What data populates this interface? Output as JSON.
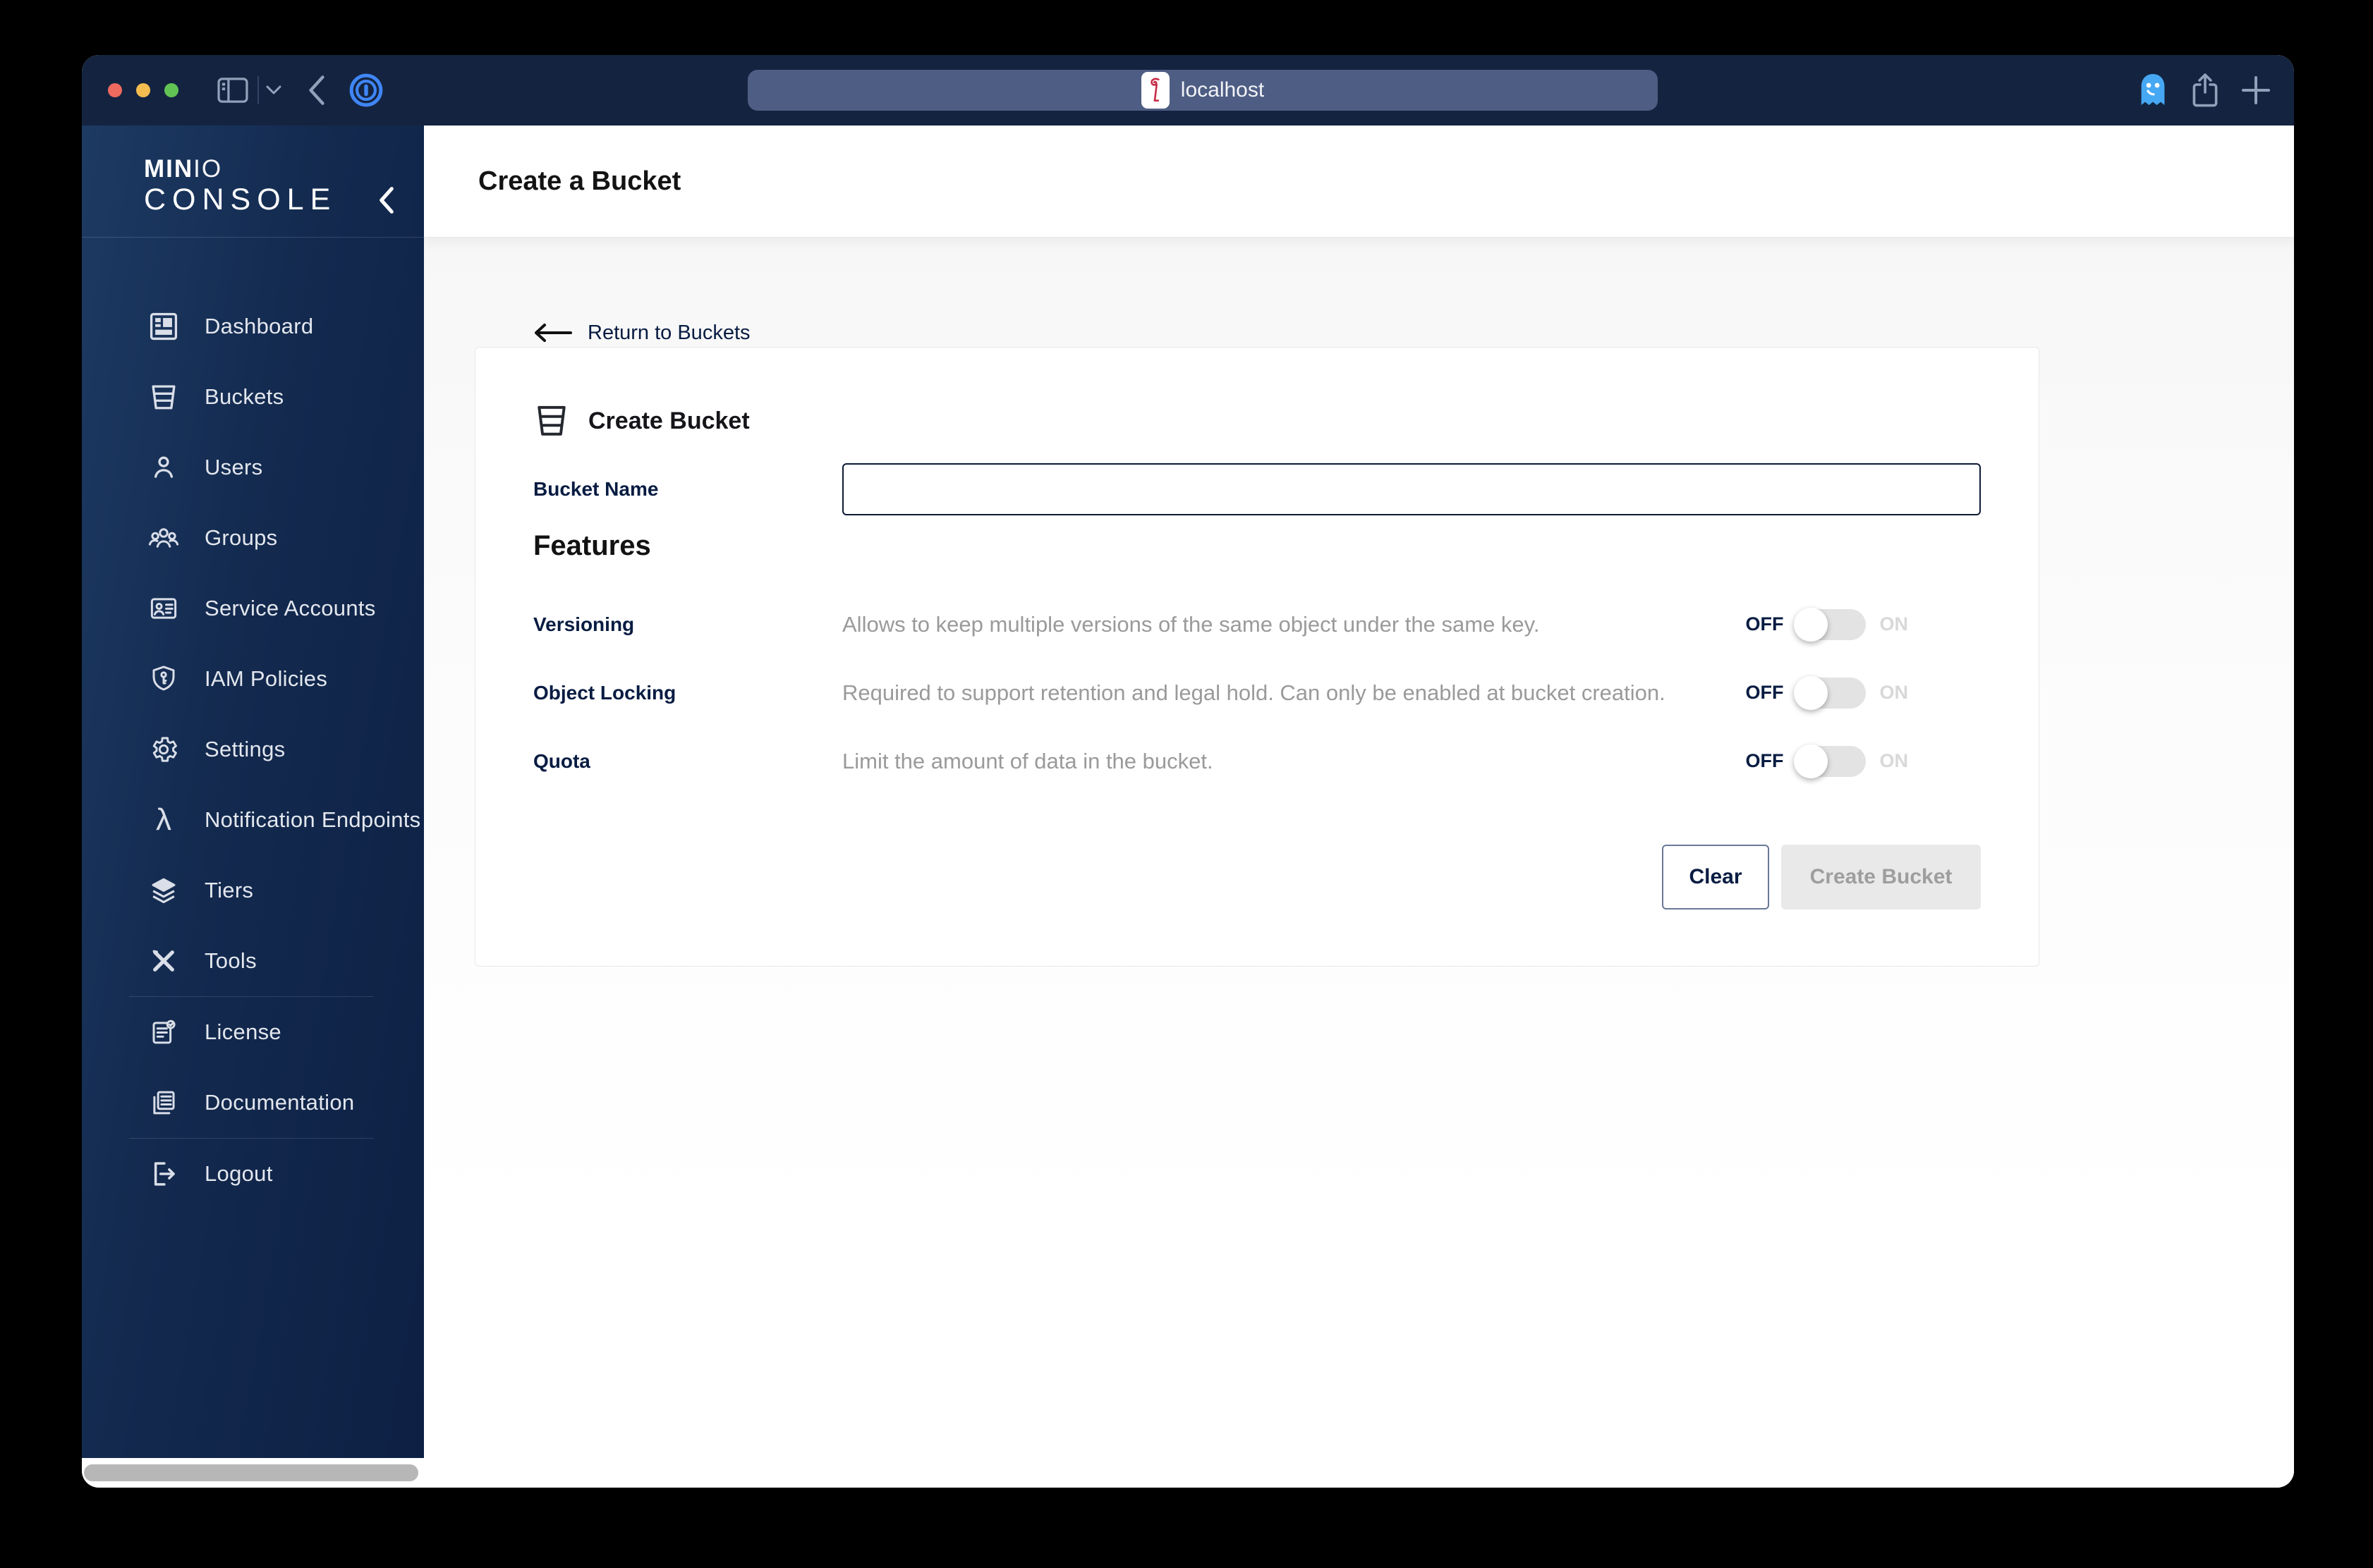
{
  "browser": {
    "url": "localhost",
    "traffic_lights": [
      "close",
      "minimize",
      "zoom"
    ]
  },
  "sidebar": {
    "logo_min": "MIN",
    "logo_io": "IO",
    "logo_console": "CONSOLE",
    "items": [
      {
        "label": "Dashboard",
        "icon": "dashboard-icon"
      },
      {
        "label": "Buckets",
        "icon": "bucket-icon"
      },
      {
        "label": "Users",
        "icon": "user-icon"
      },
      {
        "label": "Groups",
        "icon": "groups-icon"
      },
      {
        "label": "Service Accounts",
        "icon": "id-card-icon"
      },
      {
        "label": "IAM Policies",
        "icon": "shield-key-icon"
      },
      {
        "label": "Settings",
        "icon": "gear-icon"
      },
      {
        "label": "Notification Endpoints",
        "icon": "lambda-icon"
      },
      {
        "label": "Tiers",
        "icon": "layers-icon"
      },
      {
        "label": "Tools",
        "icon": "tools-icon"
      },
      {
        "label": "License",
        "icon": "license-icon"
      },
      {
        "label": "Documentation",
        "icon": "documentation-icon"
      },
      {
        "label": "Logout",
        "icon": "logout-icon"
      }
    ]
  },
  "header": {
    "title": "Create a Bucket"
  },
  "page": {
    "back_link": "Return to Buckets",
    "card_title": "Create Bucket",
    "bucket_name_label": "Bucket Name",
    "bucket_name_value": "",
    "features_title": "Features",
    "features": [
      {
        "label": "Versioning",
        "description": "Allows to keep multiple versions of the same object under the same key.",
        "state": "off",
        "off_label": "OFF",
        "on_label": "ON"
      },
      {
        "label": "Object Locking",
        "description": "Required to support retention and legal hold. Can only be enabled at bucket creation.",
        "state": "off",
        "off_label": "OFF",
        "on_label": "ON"
      },
      {
        "label": "Quota",
        "description": "Limit the amount of data in the bucket.",
        "state": "off",
        "off_label": "OFF",
        "on_label": "ON"
      }
    ],
    "buttons": {
      "clear": "Clear",
      "create": "Create Bucket"
    }
  },
  "colors": {
    "titlebar": "#142440",
    "navy": "#081C42",
    "url_bar": "#4e5d83",
    "desc_gray": "#9a9a9a",
    "toggle_track": "#e3e3e3",
    "on_gray": "#d8d8d8",
    "disabled_bg": "#e9e9e9",
    "disabled_text": "#9e9e9e",
    "traffic_red": "#ee6a5f",
    "traffic_yellow": "#f5bd4f",
    "traffic_green": "#61c354",
    "ghost_blue": "#46a8f3",
    "favicon_red": "#c72c48"
  }
}
